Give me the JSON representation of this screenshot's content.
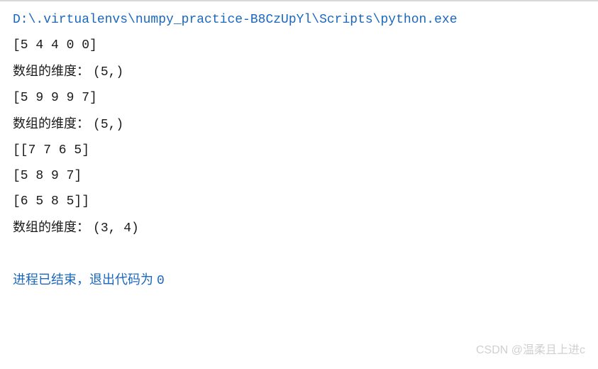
{
  "interpreter_path": "D:\\.virtualenvs\\numpy_practice-B8CzUpYl\\Scripts\\python.exe",
  "lines": {
    "arr1": "[5 4 4 0 0]",
    "dim1_label": "数组的维度： ",
    "dim1_value": "(5,)",
    "arr2": "[5 9 9 9 7]",
    "dim2_label": "数组的维度： ",
    "dim2_value": "(5,)",
    "arr3_row1": "[[7 7 6 5]",
    "arr3_row2": " [5 8 9 7]",
    "arr3_row3": " [6 5 8 5]]",
    "dim3_label": "数组的维度： ",
    "dim3_value": "(3, 4)"
  },
  "exit": {
    "text": "进程已结束，退出代码为 ",
    "code": "0"
  },
  "watermark": "CSDN @温柔且上进c"
}
